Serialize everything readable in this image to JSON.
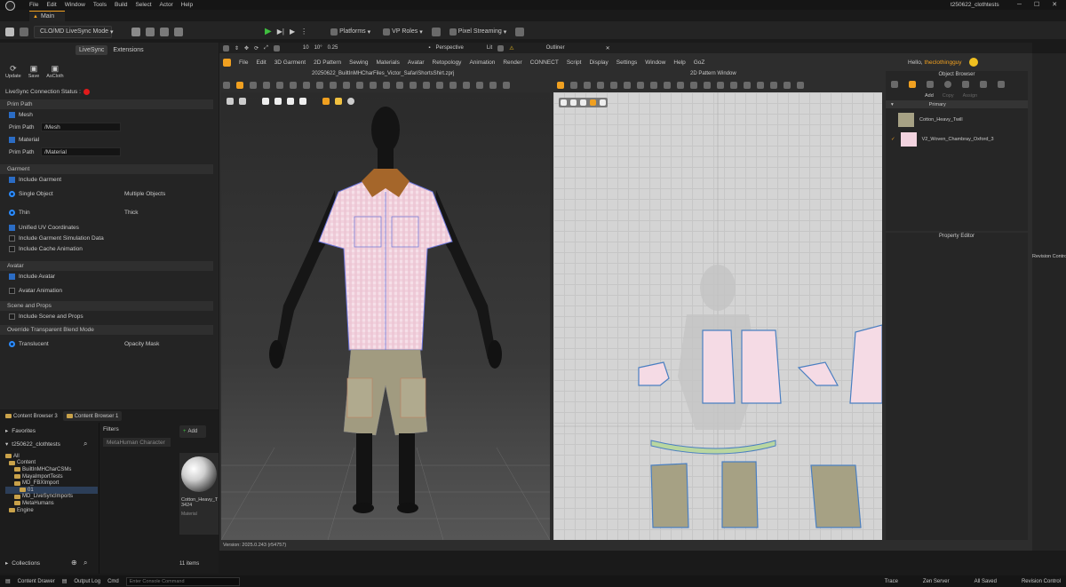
{
  "app": {
    "menu": [
      "File",
      "Edit",
      "Window",
      "Tools",
      "Build",
      "Select",
      "Actor",
      "Help"
    ],
    "project_title": "t250622_clothtests",
    "tab_main": "Main"
  },
  "toolbar": {
    "mode": "CLO/MD LiveSync Mode",
    "platforms": "Platforms",
    "vp_roles": "VP Roles",
    "pixel_streaming": "Pixel Streaming"
  },
  "livesync": {
    "tabs": [
      "LiveSync",
      "Extensions"
    ],
    "buttons": [
      "Update",
      "Save",
      "AsCloth"
    ],
    "status_label": "LiveSync Connection Status :",
    "status_color": "#e11b1b",
    "sections": {
      "prim_path": "Prim Path",
      "mesh": "Mesh",
      "prim_path_label": "Prim Path",
      "mesh_path": "/Mesh",
      "material": "Material",
      "material_path": "/Material",
      "garment": "Garment",
      "include_garment": "Include Garment",
      "single_object": "Single Object",
      "multiple_objects": "Multiple Objects",
      "thin": "Thin",
      "thick": "Thick",
      "unified_uv": "Unified UV Coordinates",
      "include_garment_sim": "Include Garment Simulation Data",
      "include_cache_anim": "Include Cache Animation",
      "avatar": "Avatar",
      "include_avatar": "Include Avatar",
      "avatar_animation": "Avatar Animation",
      "scene_props": "Scene and Props",
      "include_scene_props": "Include Scene and Props",
      "override_blend": "Override Transparent Blend Mode",
      "translucent": "Translucent",
      "opacity_mask": "Opacity Mask"
    }
  },
  "content_browser": {
    "tabs": [
      "Content Browser 3",
      "Content Browser 1"
    ],
    "add": "Add",
    "favorites": "Favorites",
    "project": "t250622_clothtests",
    "filters": "Filters",
    "filter_chip": "MetaHuman Character",
    "tree": [
      "All",
      "Content",
      "BuiltInMHCharCSMs",
      "MayaImportTests",
      "MD_FBXImport",
      "01",
      "MD_LiveSyncImports",
      "MetaHumans",
      "Engine"
    ],
    "asset_name": "Cotton_Heavy_T 3424",
    "asset_type": "Material",
    "collections": "Collections",
    "items_count": "11 items"
  },
  "viewport": {
    "perspective": "Perspective",
    "lit": "Lit",
    "fov": "10°",
    "speed": "0.25",
    "grid": "10",
    "outliner": "Outliner"
  },
  "clo": {
    "file_title": "20250622_BuiltInMHCharFiles_Victor_SafariShortsShirt.zprj",
    "menu": [
      "File",
      "Edit",
      "3D Garment",
      "2D Pattern",
      "Sewing",
      "Materials",
      "Avatar",
      "Retopology",
      "Animation",
      "Render",
      "CONNECT",
      "Script",
      "Display",
      "Settings",
      "Window",
      "Help",
      "GoZ"
    ],
    "greeting": "Hello,",
    "username": "theclothingguy",
    "pattern_window": "2D Pattern Window",
    "version": "Version: 2025.0.243 (r54757)",
    "object_browser": "Object Browser",
    "add": "Add",
    "copy": "Copy",
    "assign": "Assign",
    "primary": "Primary",
    "fabrics": [
      "Cotton_Heavy_Twill",
      "V2_Woven_Chambray_Oxford_3"
    ],
    "property_editor": "Property Editor"
  },
  "statusbar": {
    "content_drawer": "Content Drawer",
    "output_log": "Output Log",
    "cmd": "Cmd",
    "console_placeholder": "Enter Console Command",
    "trace": "Trace",
    "zen": "Zen Server",
    "saved": "All Saved",
    "revision": "Revision Control"
  },
  "colors": {
    "accent": "#2b8cff",
    "folder": "#c9a24a",
    "status_red": "#e11b1b",
    "clo_orange": "#f0a020"
  }
}
